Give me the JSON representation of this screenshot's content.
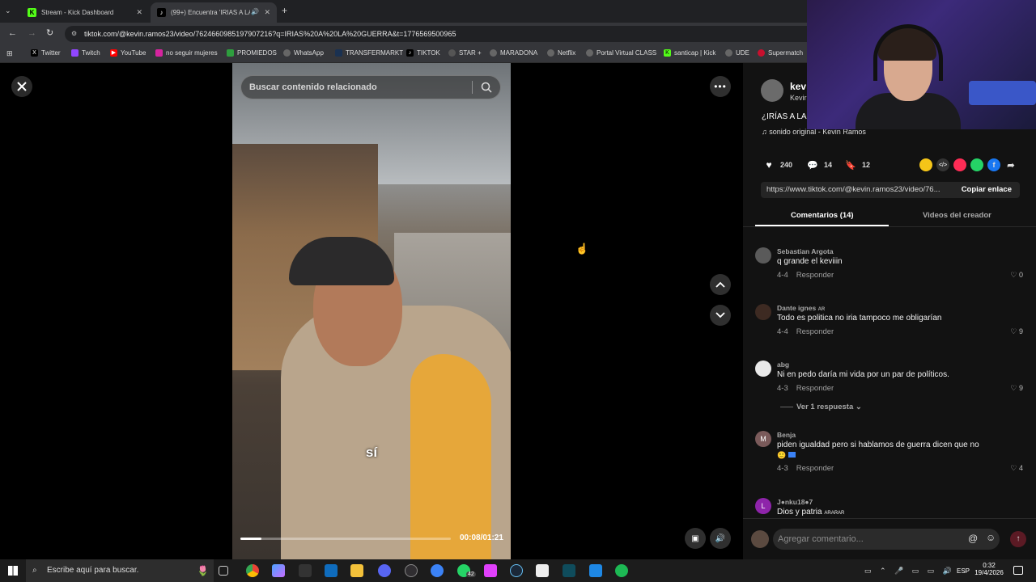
{
  "browser": {
    "tabs": [
      {
        "title": "Stream - Kick Dashboard",
        "close": "✕"
      },
      {
        "title": "(99+) Encuentra 'IRIAS A LA",
        "close": "✕"
      }
    ],
    "new_tab": "+",
    "url": "tiktok.com/@kevin.ramos23/video/7624660985197907216?q=IRIAS%20A%20LA%20GUERRA&t=1776569500965",
    "bookmarks": [
      "Twitter",
      "Twitch",
      "YouTube",
      "no seguir mujeres",
      "PROMIEDOS",
      "WhatsApp",
      "TRANSFERMARKT",
      "TIKTOK",
      "STAR +",
      "MARADONA",
      "Netflix",
      "Portal Virtual CLASS",
      "santicap | Kick",
      "UDE",
      "Supermatch"
    ]
  },
  "player": {
    "search_placeholder": "Buscar contenido relacionado",
    "subtitle": "sí",
    "time": "00:08/01:21",
    "progress": 0.1
  },
  "panel": {
    "author_short": "kev",
    "author_sub": "Kevir",
    "caption_short": "¿IRÍAS A LA",
    "sound": "sonido original - Kevin Ramos",
    "likes": "240",
    "comments_count": "14",
    "saves": "12",
    "link": "https://www.tiktok.com/@kevin.ramos23/video/76...",
    "copy_label": "Copiar enlace",
    "tab_comments": "Comentarios (14)",
    "tab_creator": "Videos del creador",
    "reply_label": "Responder",
    "more_replies": "Ver 1 respuesta",
    "add_comment_placeholder": "Agregar comentario...",
    "comments": [
      {
        "name": "Sebastian Argota",
        "text": "q grande el keviiin",
        "date": "4-4",
        "likes": "0",
        "avatar": ""
      },
      {
        "name": "Dante ignes",
        "name_tag": "AR",
        "text": "Todo es politica no iria tampoco me obligarían",
        "date": "4-4",
        "likes": "9",
        "avatar": ""
      },
      {
        "name": "abg",
        "text": "Ni en pedo daría mi vida por un par de políticos.",
        "date": "4-3",
        "likes": "9",
        "avatar": ""
      },
      {
        "name": "Benja",
        "text": "piden igualdad pero si hablamos de guerra dicen que no",
        "date": "4-3",
        "likes": "4",
        "avatar": "M"
      },
      {
        "name": "J●nku18●7",
        "text": "Dios y patria",
        "name_tag": "ARARAR",
        "date": "",
        "likes": "",
        "avatar": "L"
      }
    ]
  },
  "taskbar": {
    "search_placeholder": "Escribe aquí para buscar.",
    "whatsapp_badge": "42",
    "lang": "ESP",
    "time": "0:32",
    "date": "19/4/2026"
  },
  "colors": {
    "kick_green": "#53fc18",
    "tiktok_red": "#fe2c55"
  }
}
